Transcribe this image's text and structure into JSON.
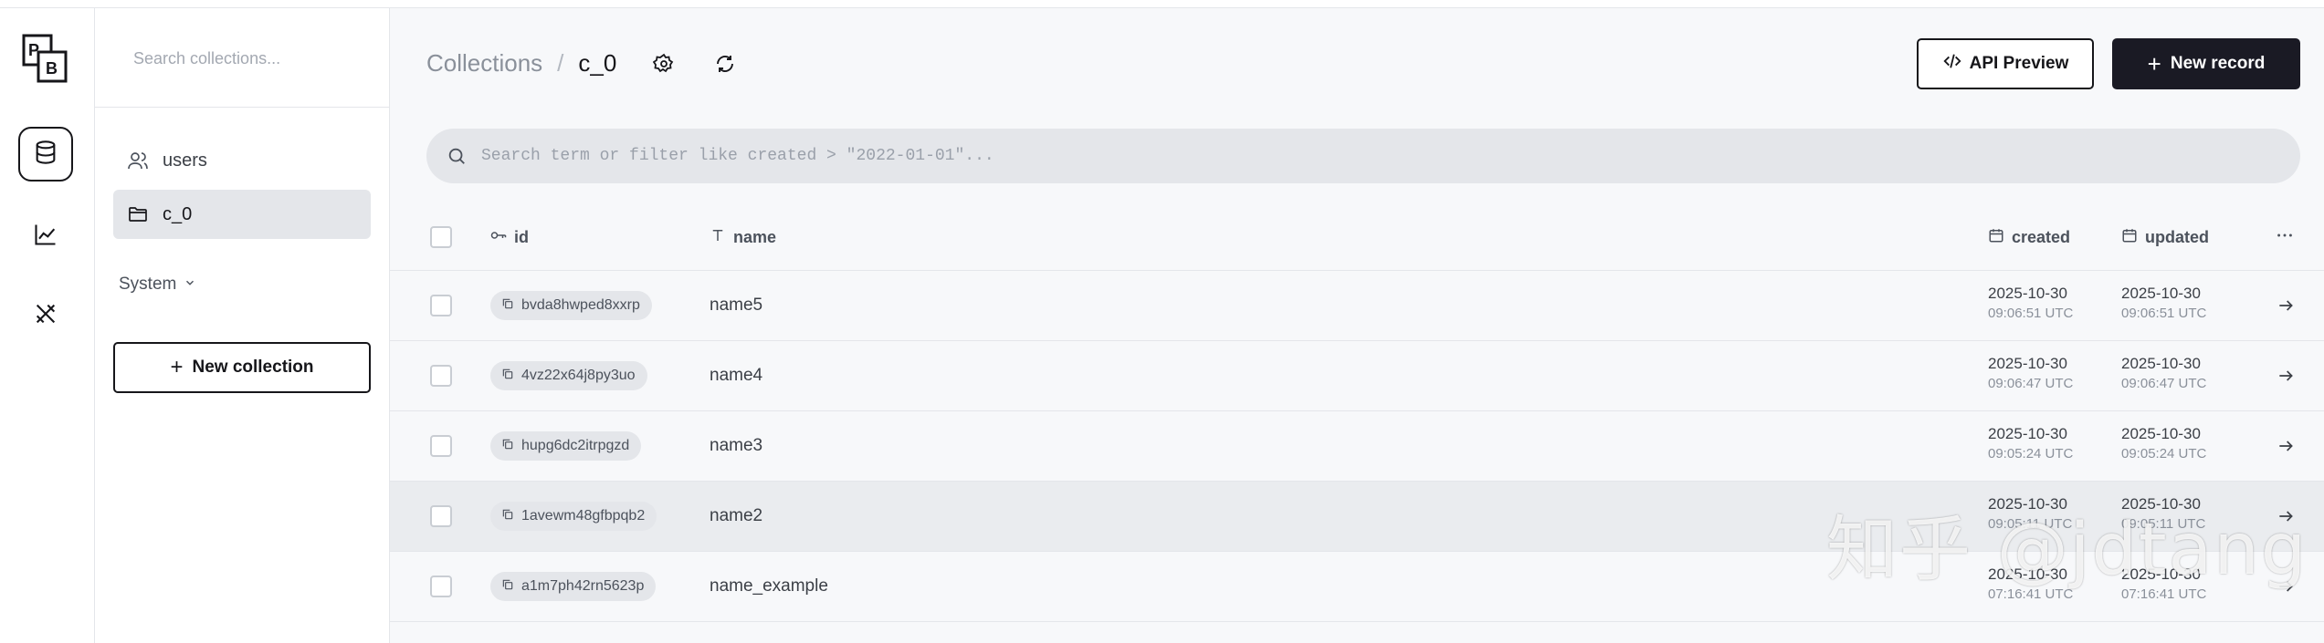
{
  "sidebar": {
    "search_placeholder": "Search collections...",
    "items": [
      {
        "label": "users",
        "icon": "user-icon",
        "active": false
      },
      {
        "label": "c_0",
        "icon": "folder-icon",
        "active": true
      }
    ],
    "system_label": "System",
    "new_collection_label": "New collection"
  },
  "rail": {
    "logo_text": "PB",
    "items": [
      "database-icon",
      "chart-icon",
      "tools-icon"
    ]
  },
  "header": {
    "breadcrumb_root": "Collections",
    "breadcrumb_sep": "/",
    "breadcrumb_current": "c_0",
    "api_preview_label": "API Preview",
    "new_record_label": "New record"
  },
  "search": {
    "placeholder": "Search term or filter like created > \"2022-01-01\"..."
  },
  "table": {
    "columns": {
      "id": "id",
      "name": "name",
      "created": "created",
      "updated": "updated"
    },
    "rows": [
      {
        "id": "bvda8hwped8xxrp",
        "name": "name5",
        "created_date": "2025-10-30",
        "created_time": "09:06:51 UTC",
        "updated_date": "2025-10-30",
        "updated_time": "09:06:51 UTC"
      },
      {
        "id": "4vz22x64j8py3uo",
        "name": "name4",
        "created_date": "2025-10-30",
        "created_time": "09:06:47 UTC",
        "updated_date": "2025-10-30",
        "updated_time": "09:06:47 UTC"
      },
      {
        "id": "hupg6dc2itrpgzd",
        "name": "name3",
        "created_date": "2025-10-30",
        "created_time": "09:05:24 UTC",
        "updated_date": "2025-10-30",
        "updated_time": "09:05:24 UTC"
      },
      {
        "id": "1avewm48gfbpqb2",
        "name": "name2",
        "created_date": "2025-10-30",
        "created_time": "09:05:11 UTC",
        "updated_date": "2025-10-30",
        "updated_time": "09:05:11 UTC"
      },
      {
        "id": "a1m7ph42rn5623p",
        "name": "name_example",
        "created_date": "2025-10-30",
        "created_time": "07:16:41 UTC",
        "updated_date": "2025-10-30",
        "updated_time": "07:16:41 UTC"
      }
    ]
  },
  "watermark": "知乎 @jdtang"
}
